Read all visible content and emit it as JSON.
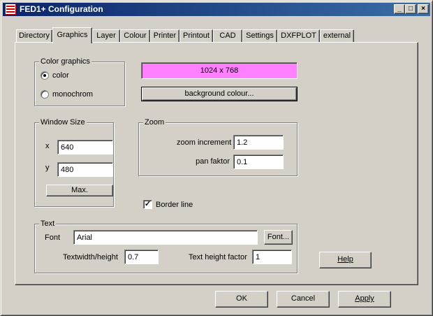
{
  "window": {
    "title": "FED1+ Configuration",
    "minimize_glyph": "_",
    "maximize_glyph": "□",
    "close_glyph": "×"
  },
  "tabs": [
    {
      "label": "Directory"
    },
    {
      "label": "Graphics",
      "active": true
    },
    {
      "label": "Layer"
    },
    {
      "label": "Colour"
    },
    {
      "label": "Printer"
    },
    {
      "label": "Printout"
    },
    {
      "label": "CAD"
    },
    {
      "label": "Settings"
    },
    {
      "label": "DXFPLOT"
    },
    {
      "label": "external"
    }
  ],
  "color_graphics": {
    "group_label": "Color graphics",
    "options": [
      {
        "label": "color",
        "selected": true
      },
      {
        "label": "monochrom",
        "selected": false
      }
    ]
  },
  "resolution": {
    "text": "1024 x 768",
    "color": "#ff80ff"
  },
  "background_colour_button": "background colour...",
  "window_size": {
    "group_label": "Window Size",
    "x_label": "x",
    "x_value": "640",
    "y_label": "y",
    "y_value": "480",
    "max_button": "Max."
  },
  "zoom": {
    "group_label": "Zoom",
    "increment_label": "zoom increment",
    "increment_value": "1.2",
    "pan_label": "pan faktor",
    "pan_value": "0.1"
  },
  "border_line": {
    "label": "Border line",
    "checked": true
  },
  "text": {
    "group_label": "Text",
    "font_label": "Font",
    "font_value": "Arial",
    "font_button": "Font...",
    "width_height_label": "Textwidth/height",
    "width_height_value": "0.7",
    "height_factor_label": "Text height factor",
    "height_factor_value": "1"
  },
  "help_button": "Help",
  "footer": {
    "ok": "OK",
    "cancel": "Cancel",
    "apply": "Apply"
  },
  "colors": {
    "titlebar_start": "#0a246a",
    "titlebar_end": "#3a6ea5",
    "face": "#d4d0c8"
  }
}
